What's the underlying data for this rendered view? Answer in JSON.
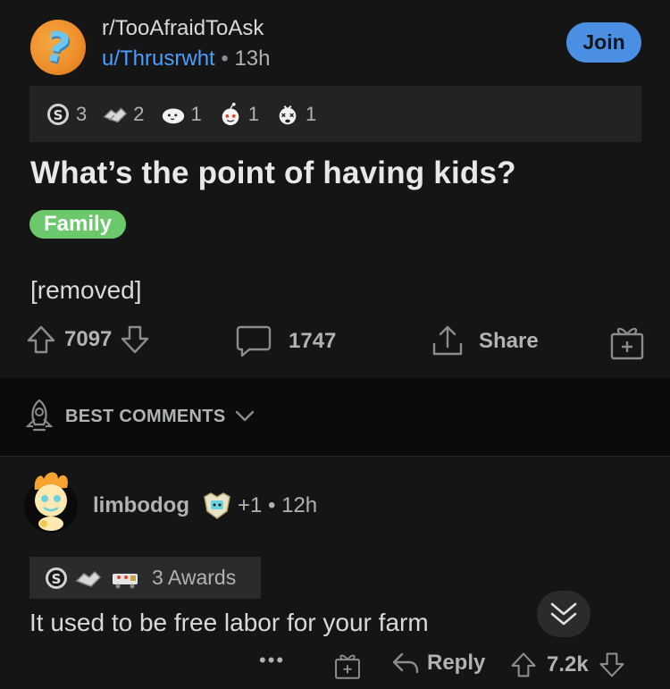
{
  "post": {
    "subreddit": "r/TooAfraidToAsk",
    "author": "u/Thrusrwht",
    "separator": "•",
    "time": "13h",
    "join_label": "Join",
    "awards": [
      {
        "icon": "silver-award-icon",
        "count": "3"
      },
      {
        "icon": "handshake-award-icon",
        "count": "2"
      },
      {
        "icon": "cat-award-icon",
        "count": "1"
      },
      {
        "icon": "snoo-award-icon",
        "count": "1"
      },
      {
        "icon": "dizzy-face-award-icon",
        "count": "1"
      }
    ],
    "title": "What’s the point of having kids?",
    "flair": "Family",
    "body": "[removed]",
    "score": "7097",
    "comment_count": "1747",
    "share_label": "Share"
  },
  "sort": {
    "label": "BEST COMMENTS"
  },
  "comment": {
    "username": "limbodog",
    "meta": "+1 • 12h",
    "awards_label": "3 Awards",
    "body": "It used to be free labor for your farm",
    "more": "•••",
    "reply_label": "Reply",
    "score": "7.2k"
  },
  "colors": {
    "background": "#151515",
    "accent": "#4a8fe4",
    "username_link": "#4a9eff",
    "flair": "#6cc96b"
  }
}
